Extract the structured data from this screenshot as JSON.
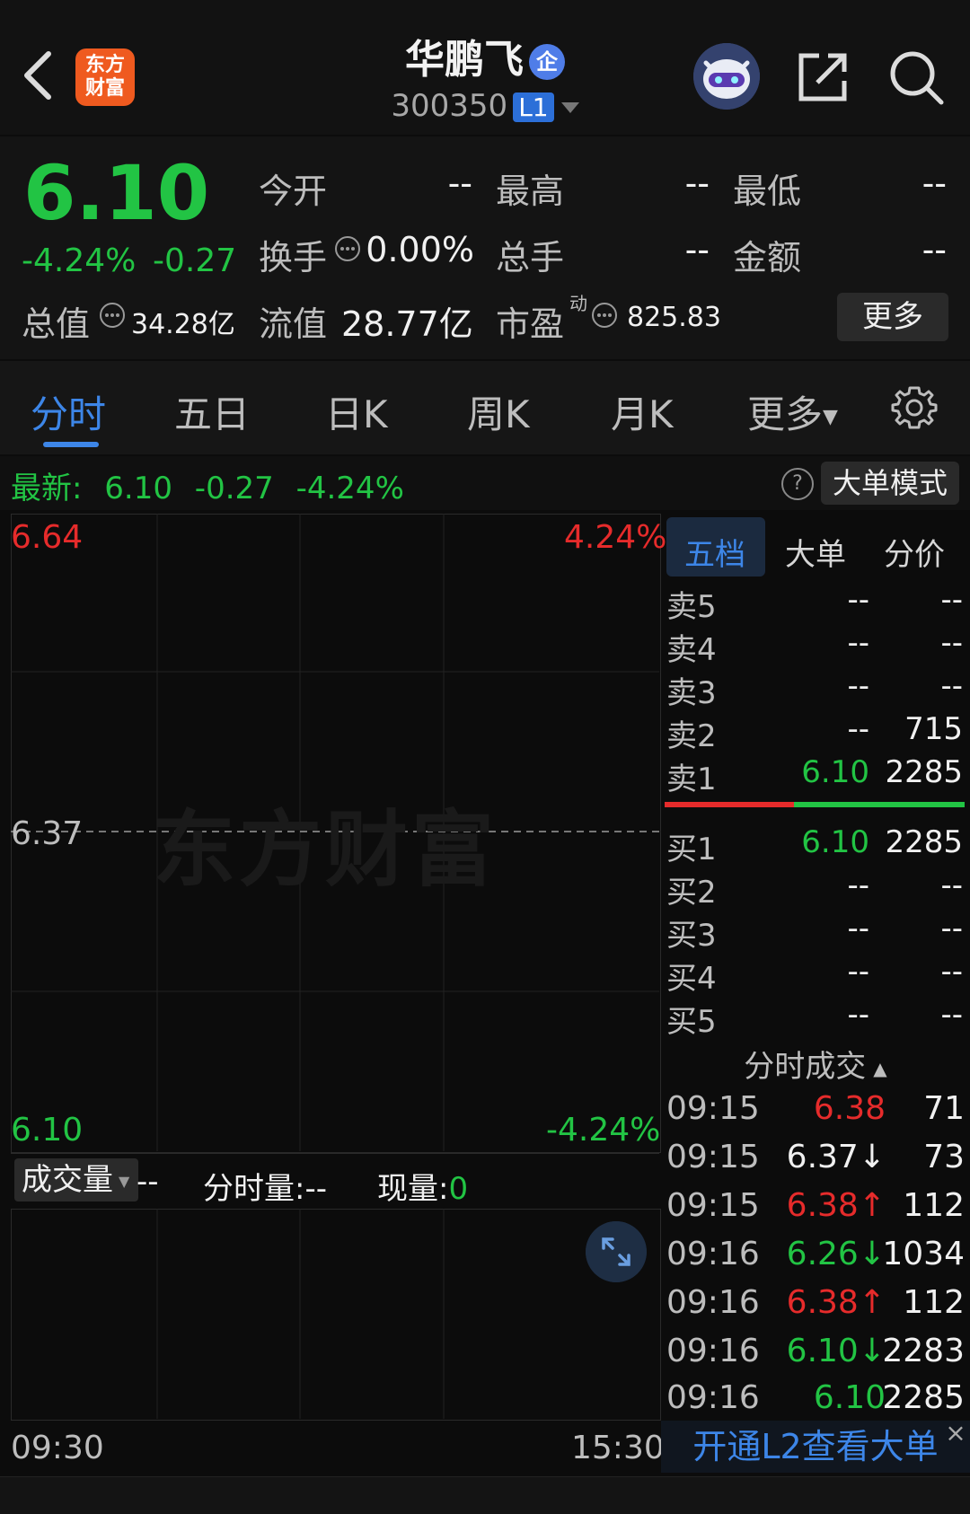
{
  "header": {
    "logo_line1": "东方",
    "logo_line2": "财富",
    "stock_name": "华鹏飞",
    "enterprise_badge": "企",
    "stock_code": "300350",
    "level_badge": "L1",
    "icons": [
      "back-icon",
      "robot-avatar-icon",
      "share-icon",
      "search-icon"
    ]
  },
  "quote": {
    "price": "6.10",
    "change_pct": "-4.24%",
    "change": "-0.27",
    "today_open_label": "今开",
    "today_open": "--",
    "high_label": "最高",
    "high": "--",
    "low_label": "最低",
    "low": "--",
    "turnover_label": "换手",
    "turnover": "0.00%",
    "volume_label": "总手",
    "volume": "--",
    "amount_label": "金额",
    "amount": "--",
    "total_value_label": "总值",
    "total_value": "34.28亿",
    "float_value_label": "流值",
    "float_value": "28.77亿",
    "pe_label": "市盈",
    "pe_sup": "动",
    "pe": "825.83",
    "more_button": "更多"
  },
  "tabs": [
    "分时",
    "五日",
    "日K",
    "周K",
    "月K",
    "更多"
  ],
  "latest": {
    "label": "最新:",
    "price": "6.10",
    "change": "-0.27",
    "pct": "-4.24%",
    "help": "?",
    "big_order_button": "大单模式"
  },
  "chart": {
    "watermark": "东方财富",
    "y_top": "6.64",
    "y_mid": "6.37",
    "y_bottom": "6.10",
    "pct_top": "4.24%",
    "pct_bottom": "-4.24%",
    "volume_select": "成交量",
    "volume_value": "--",
    "minute_volume_label": "分时量:--",
    "current_volume_label": "现量:",
    "current_volume_value": "0",
    "time_start": "09:30",
    "time_end": "15:30"
  },
  "order_book": {
    "tabs": [
      "五档",
      "大单",
      "分价"
    ],
    "asks": [
      {
        "name": "卖5",
        "price": "--",
        "volume": "--"
      },
      {
        "name": "卖4",
        "price": "--",
        "volume": "--"
      },
      {
        "name": "卖3",
        "price": "--",
        "volume": "--"
      },
      {
        "name": "卖2",
        "price": "--",
        "volume": "715"
      },
      {
        "name": "卖1",
        "price": "6.10",
        "volume": "2285"
      }
    ],
    "bids": [
      {
        "name": "买1",
        "price": "6.10",
        "volume": "2285"
      },
      {
        "name": "买2",
        "price": "--",
        "volume": "--"
      },
      {
        "name": "买3",
        "price": "--",
        "volume": "--"
      },
      {
        "name": "买4",
        "price": "--",
        "volume": "--"
      },
      {
        "name": "买5",
        "price": "--",
        "volume": "--"
      }
    ],
    "ticks_title": "分时成交",
    "ticks": [
      {
        "time": "09:15",
        "price": "6.38",
        "volume": "71",
        "color": "#e62b2b"
      },
      {
        "time": "09:15",
        "price": "6.37↓",
        "volume": "73",
        "color": "#f0f0f0"
      },
      {
        "time": "09:15",
        "price": "6.38↑",
        "volume": "112",
        "color": "#e62b2b"
      },
      {
        "time": "09:16",
        "price": "6.26↓",
        "volume": "1034",
        "color": "#22c444"
      },
      {
        "time": "09:16",
        "price": "6.38↑",
        "volume": "112",
        "color": "#e62b2b"
      },
      {
        "time": "09:16",
        "price": "6.10↓",
        "volume": "2283",
        "color": "#22c444"
      },
      {
        "time": "09:16",
        "price": "6.10",
        "volume": "2285",
        "color": "#22c444"
      }
    ],
    "l2_banner": "开通L2查看大单",
    "l2_close": "×"
  },
  "colors": {
    "up": "#e62b2b",
    "down": "#22c444",
    "accent": "#3d86e8",
    "background": "#0c0c0c"
  }
}
